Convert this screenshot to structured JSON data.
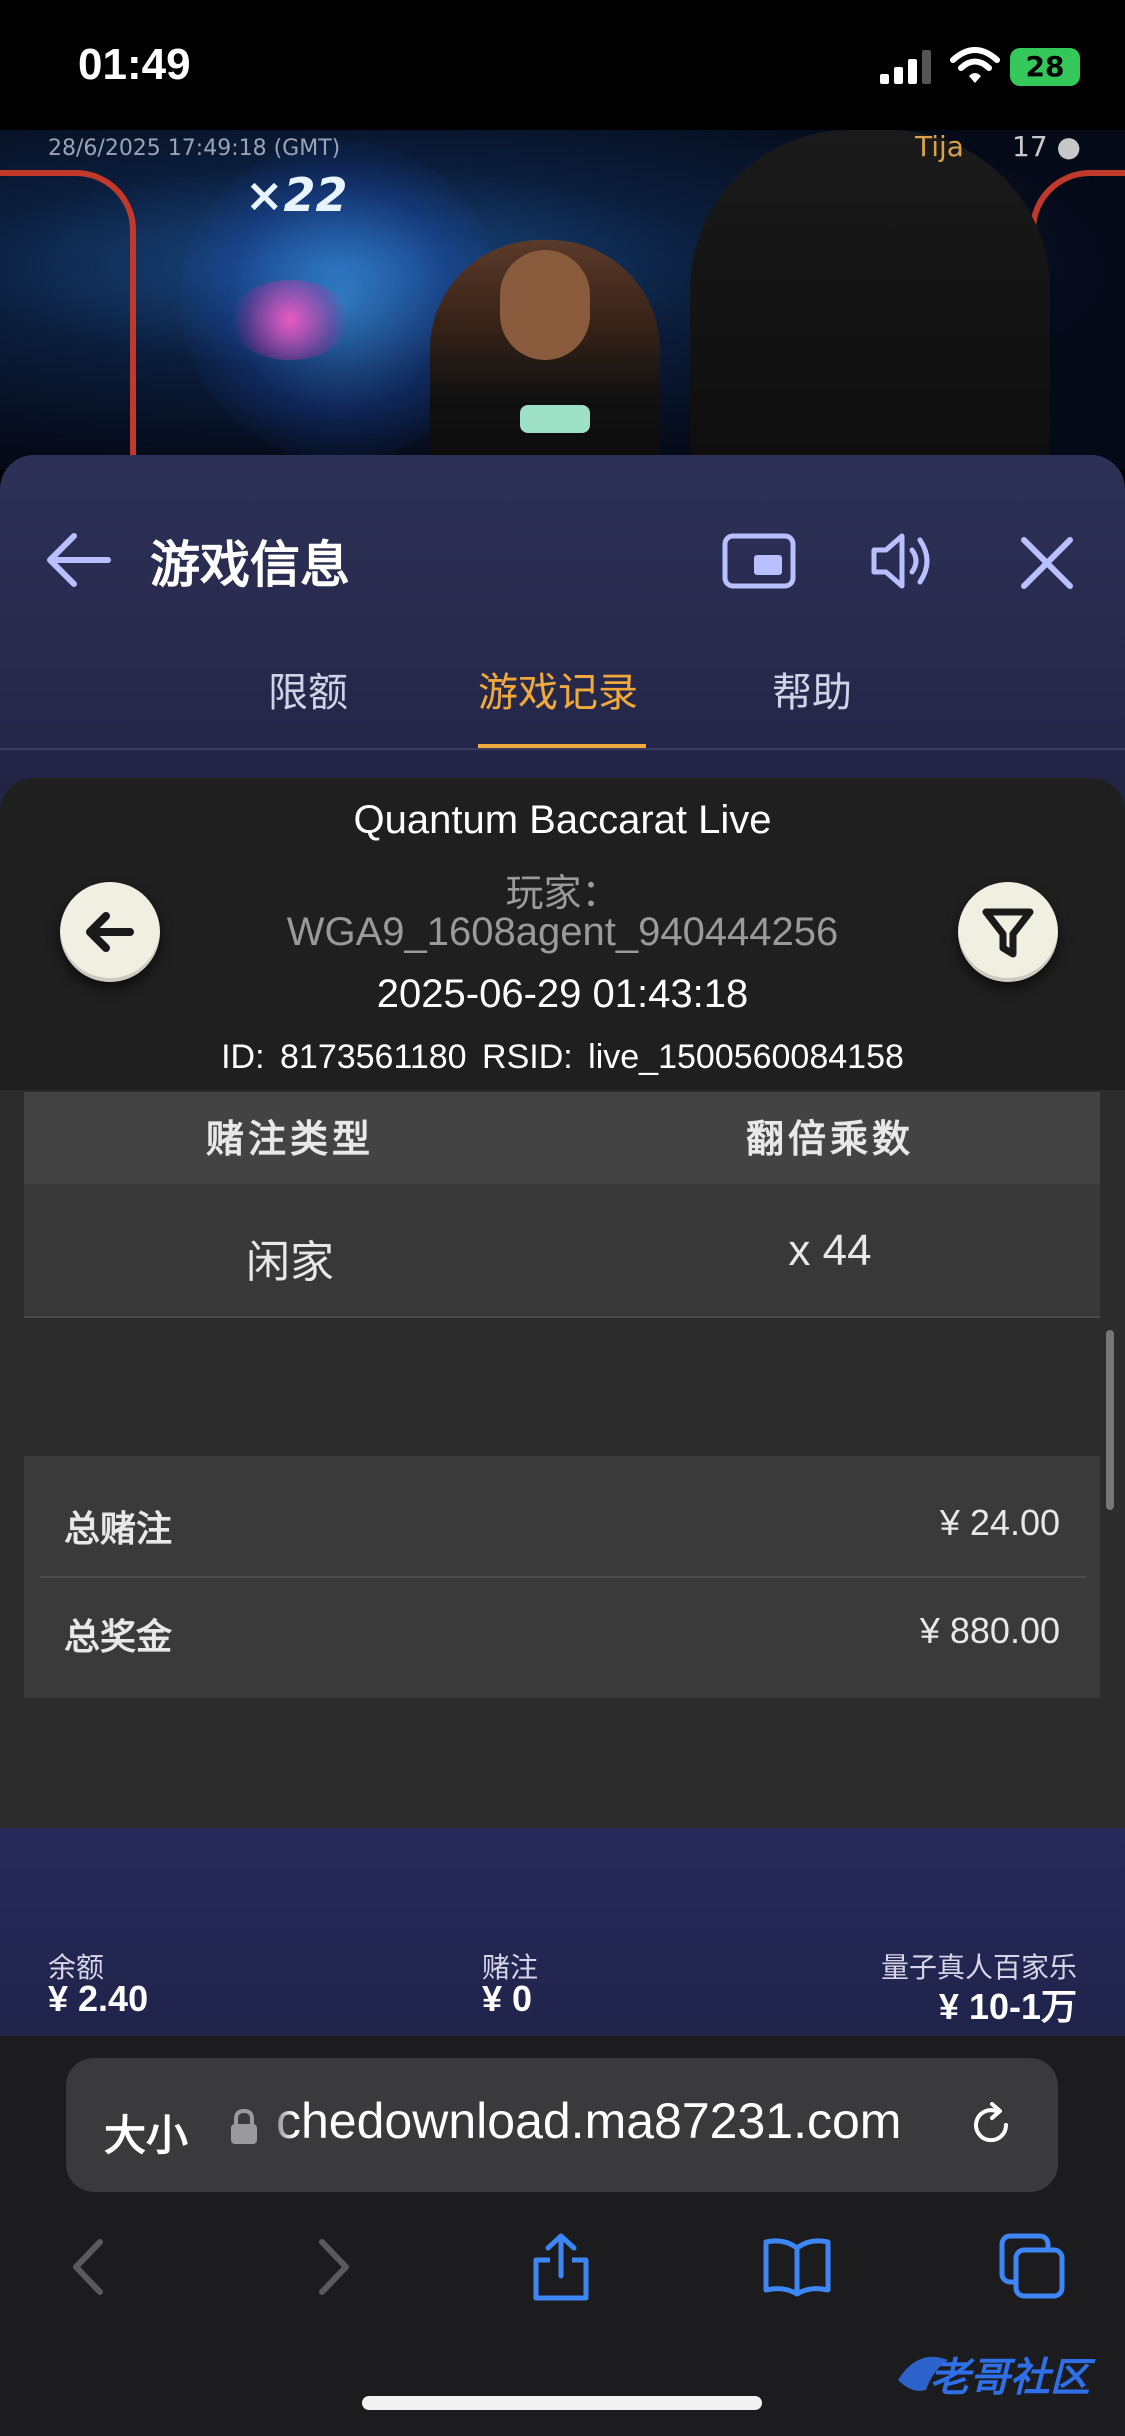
{
  "status_bar": {
    "time": "01:49",
    "battery": "28"
  },
  "video": {
    "timestamp": "28/6/2025 17:49:18 (GMT)",
    "table_name": "Tija",
    "viewer_count": "17",
    "multiplier": "×22"
  },
  "panel": {
    "title": "游戏信息",
    "tabs": [
      {
        "label": "限额",
        "active": false
      },
      {
        "label": "游戏记录",
        "active": true
      },
      {
        "label": "帮助",
        "active": false
      }
    ],
    "accent_color": "#f0a93a"
  },
  "record": {
    "game_name": "Quantum Baccarat Live",
    "player_label": "玩家：",
    "player_id": "WGA9_1608agent_940444256",
    "round_time": "2025-06-29  01:43:18",
    "round_ids": "ID: 8173561180    RSID: live_1500560084158",
    "table": {
      "headers": [
        "赌注类型",
        "翻倍乘数"
      ],
      "rows": [
        [
          "闲家",
          "x 44"
        ]
      ]
    },
    "summary": {
      "total_bet_label": "总赌注",
      "total_bet_value": "¥ 24.00",
      "total_win_label": "总奖金",
      "total_win_value": "¥ 880.00"
    }
  },
  "bottom_bar": {
    "balance_label": "余额",
    "balance_value": "¥ 2.40",
    "bet_label": "赌注",
    "bet_value": "¥ 0",
    "limit_label": "量子真人百家乐",
    "limit_value": "¥ 10-1万"
  },
  "browser": {
    "text_size": "大小",
    "url": "chedownload.ma87231.com",
    "icons": [
      "lock-icon",
      "reload-icon",
      "back-icon",
      "forward-icon",
      "share-icon",
      "bookmarks-icon",
      "tabs-icon"
    ]
  },
  "watermark": "老哥社区"
}
